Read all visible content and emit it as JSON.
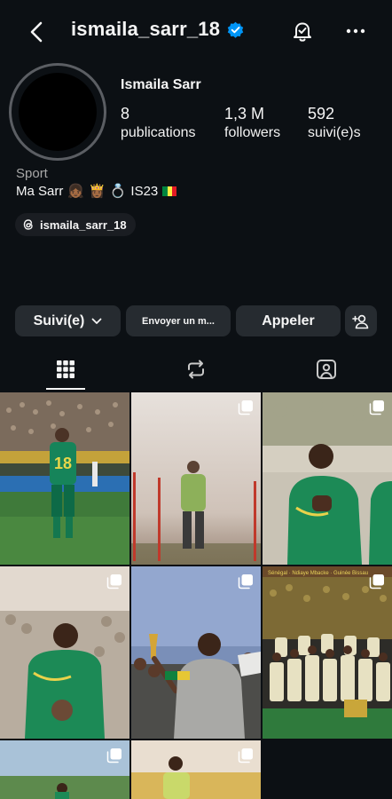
{
  "header": {
    "username": "ismaila_sarr_18",
    "icons": [
      "back-arrow-icon",
      "verified-badge-icon",
      "notification-bell-icon",
      "more-options-icon"
    ]
  },
  "profile": {
    "name": "Ismaila Sarr",
    "stats": [
      {
        "value": "8",
        "label": "publications"
      },
      {
        "value": "1,3 M",
        "label": "followers"
      },
      {
        "value": "592",
        "label": "suivi(e)s"
      }
    ],
    "category": "Sport",
    "bio": {
      "text_start": "Ma Sarr",
      "emojis": [
        "👧🏾",
        "👸🏾",
        "💍"
      ],
      "text_end": "IS23",
      "flag_colors": [
        "#00853f",
        "#fdef42",
        "#e31b23"
      ]
    },
    "threads_handle": "ismaila_sarr_18"
  },
  "actions": {
    "follow_label": "Suivi(e)",
    "message_label": "Envoyer un m...",
    "call_label": "Appeler"
  },
  "tabs": [
    {
      "icon": "grid-icon",
      "active": true
    },
    {
      "icon": "reels-icon",
      "active": false
    },
    {
      "icon": "tagged-icon",
      "active": false
    }
  ],
  "posts": [
    {
      "type": "single",
      "jersey_number": "18"
    },
    {
      "type": "multi"
    },
    {
      "type": "multi"
    },
    {
      "type": "multi"
    },
    {
      "type": "multi"
    },
    {
      "type": "multi",
      "banner_text": "Sénégal · Ndiaye Mbacke · Guinée Bissau"
    },
    {
      "type": "multi"
    },
    {
      "type": "multi"
    }
  ],
  "colors": {
    "background": "#0c1014",
    "button": "#262b30",
    "verified": "#0095f6",
    "senegal_green": "#0e7a47"
  }
}
